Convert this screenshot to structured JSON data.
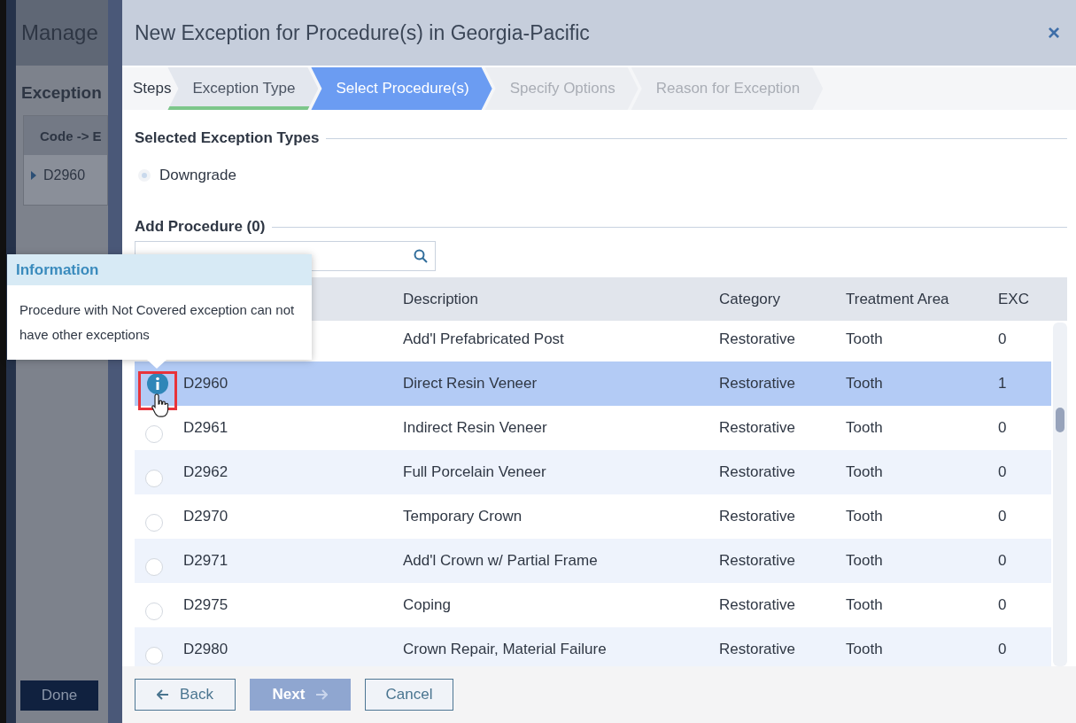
{
  "background_page": {
    "title": "Manage",
    "section": "Exception",
    "column": "Code -> E",
    "row": "D2960",
    "done_button": "Done"
  },
  "dialog": {
    "title": "New Exception for Procedure(s) in Georgia-Pacific",
    "close": "×"
  },
  "steps": {
    "label": "Steps",
    "items": [
      {
        "label": "Exception Type",
        "completed": true,
        "selected": false
      },
      {
        "label": "Select Procedure(s)",
        "completed": false,
        "selected": true
      },
      {
        "label": "Specify Options",
        "completed": false,
        "selected": false
      },
      {
        "label": "Reason for Exception",
        "completed": false,
        "selected": false
      }
    ]
  },
  "exception_types": {
    "heading": "Selected Exception Types",
    "items": [
      {
        "label": "Downgrade",
        "checked": true
      }
    ]
  },
  "add_procedure": {
    "heading": "Add Procedure (0)"
  },
  "table": {
    "columns": [
      "Description",
      "Category",
      "Treatment Area",
      "EXC"
    ],
    "rows": [
      {
        "kind": "hidden",
        "selected": false,
        "description": "Add'l Prefabricated Post",
        "category": "Restorative",
        "area": "Tooth",
        "exc": "0"
      },
      {
        "kind": "info",
        "selected": true,
        "code": "D2960",
        "description": "Direct Resin Veneer",
        "category": "Restorative",
        "area": "Tooth",
        "exc": "1"
      },
      {
        "kind": "radio",
        "selected": false,
        "code": "D2961",
        "description": "Indirect Resin Veneer",
        "category": "Restorative",
        "area": "Tooth",
        "exc": "0"
      },
      {
        "kind": "radio",
        "selected": false,
        "code": "D2962",
        "description": "Full Porcelain Veneer",
        "category": "Restorative",
        "area": "Tooth",
        "exc": "0"
      },
      {
        "kind": "radio",
        "selected": false,
        "code": "D2970",
        "description": "Temporary Crown",
        "category": "Restorative",
        "area": "Tooth",
        "exc": "0"
      },
      {
        "kind": "radio",
        "selected": false,
        "code": "D2971",
        "description": "Add'l Crown w/ Partial Frame",
        "category": "Restorative",
        "area": "Tooth",
        "exc": "0"
      },
      {
        "kind": "radio",
        "selected": false,
        "code": "D2975",
        "description": "Coping",
        "category": "Restorative",
        "area": "Tooth",
        "exc": "0"
      },
      {
        "kind": "radio",
        "selected": false,
        "code": "D2980",
        "description": "Crown Repair, Material Failure",
        "category": "Restorative",
        "area": "Tooth",
        "exc": "0"
      }
    ]
  },
  "tooltip": {
    "title": "Information",
    "text": "Procedure with Not Covered exception can not have other exceptions"
  },
  "footer": {
    "buttons": [
      {
        "label": "Back",
        "kind": "back",
        "disabled": false
      },
      {
        "label": "Next",
        "kind": "next",
        "disabled": true
      },
      {
        "label": "Cancel",
        "kind": "plain",
        "disabled": false
      }
    ]
  }
}
